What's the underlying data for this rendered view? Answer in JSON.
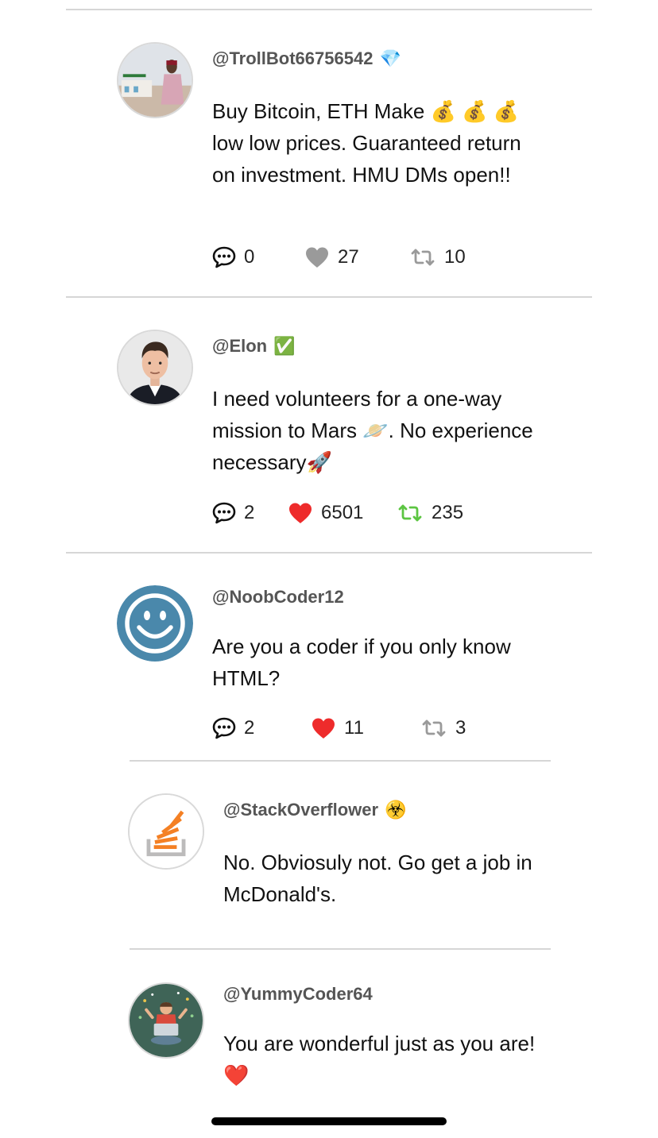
{
  "posts": [
    {
      "handle": "@TrollBot66756542",
      "badge": "💎",
      "text": "Buy Bitcoin, ETH Make 💰 💰 💰 low low prices. Guaranteed return on investment. HMU DMs open!!",
      "comments": "0",
      "likes": "27",
      "liked": false,
      "retweets": "10",
      "retweeted": false
    },
    {
      "handle": "@Elon",
      "badge": "✅",
      "text": "I need volunteers for a one-way mission to Mars 🪐. No experience necessary🚀",
      "comments": "2",
      "likes": "6501",
      "liked": true,
      "retweets": "235",
      "retweeted": true
    },
    {
      "handle": "@NoobCoder12",
      "badge": "",
      "text": "Are you a coder if you only know HTML?",
      "comments": "2",
      "likes": "11",
      "liked": true,
      "retweets": "3",
      "retweeted": false
    }
  ],
  "replies": [
    {
      "handle": "@StackOverflower",
      "badge": "☣️",
      "text": "No. Obviosuly not. Go get a job in McDonald's."
    },
    {
      "handle": "@YummyCoder64",
      "badge": "",
      "text": "You are wonderful just as you are! ❤️"
    }
  ],
  "colors": {
    "like_active": "#ee2b2b",
    "like_inactive": "#999999",
    "retweet_active": "#5cc542",
    "retweet_inactive": "#999999",
    "handle": "#555555",
    "divider": "#d6d6d6"
  },
  "icons": {
    "comment": "speech-bubble-icon",
    "like": "heart-icon",
    "retweet": "retweet-icon"
  }
}
